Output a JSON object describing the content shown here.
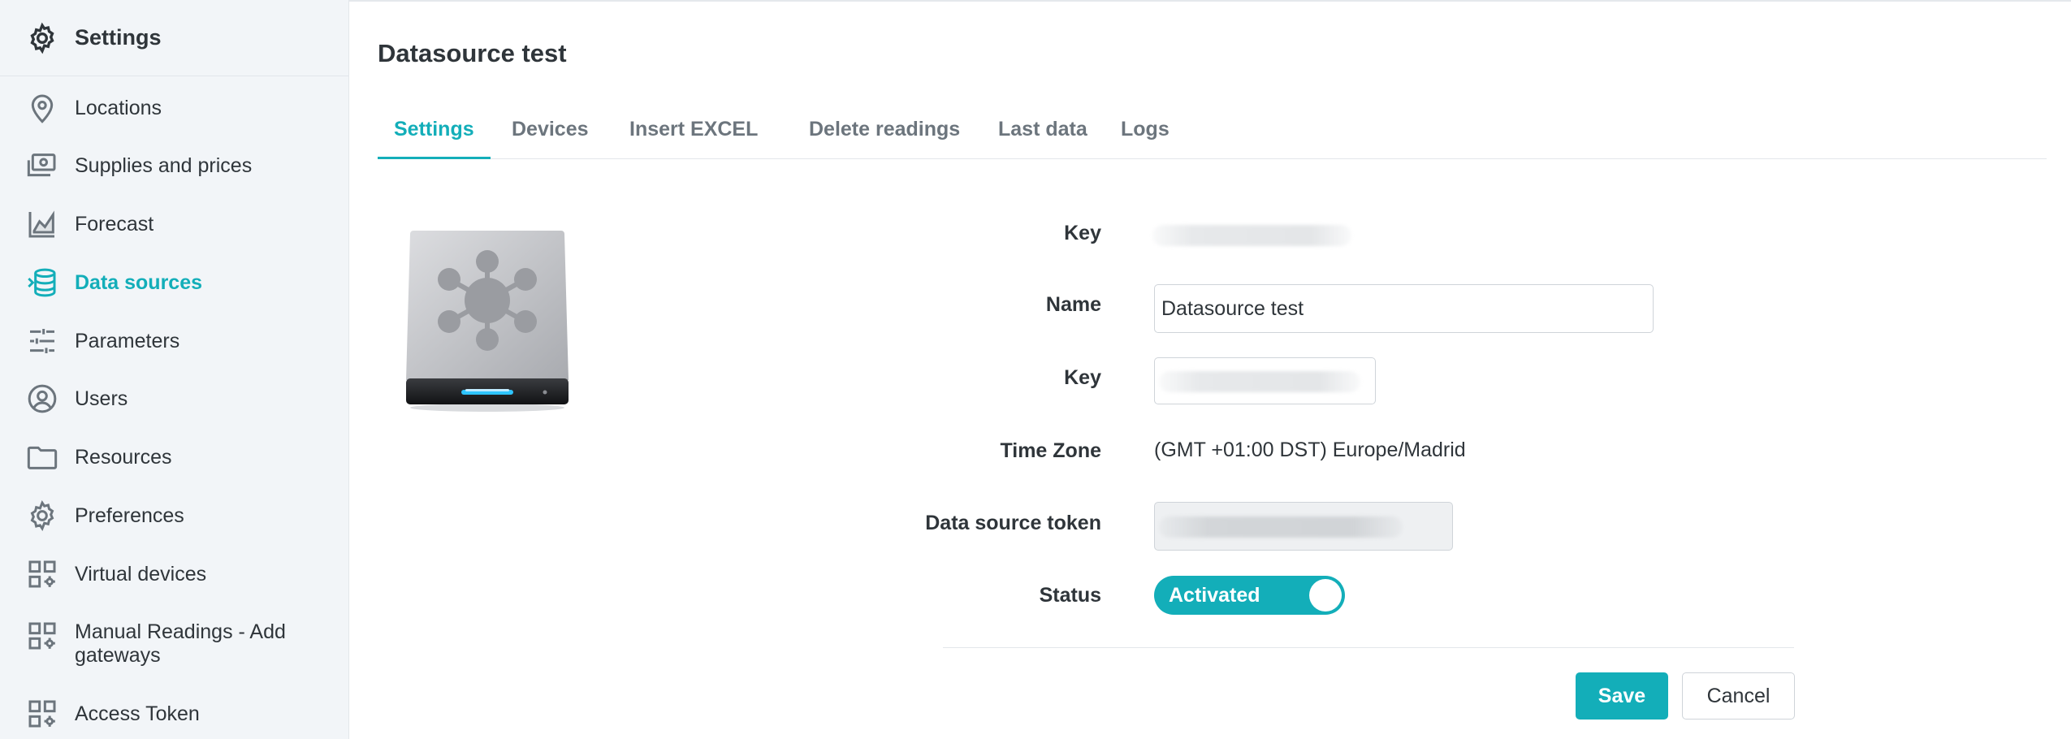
{
  "sidebar": {
    "header": {
      "title": "Settings",
      "icon": "gear-icon"
    },
    "items": [
      {
        "label": "Locations",
        "icon": "map-pin-icon",
        "active": false
      },
      {
        "label": "Supplies and prices",
        "icon": "money-icon",
        "active": false
      },
      {
        "label": "Forecast",
        "icon": "chart-area-icon",
        "active": false
      },
      {
        "label": "Data sources",
        "icon": "database-icon",
        "active": true
      },
      {
        "label": "Parameters",
        "icon": "sliders-icon",
        "active": false
      },
      {
        "label": "Users",
        "icon": "user-circle-icon",
        "active": false
      },
      {
        "label": "Resources",
        "icon": "folder-icon",
        "active": false
      },
      {
        "label": "Preferences",
        "icon": "gear-icon",
        "active": false
      },
      {
        "label": "Virtual devices",
        "icon": "grid-gear-icon",
        "active": false
      },
      {
        "label": "Manual Readings - Add gateways",
        "icon": "grid-gear-icon",
        "active": false
      },
      {
        "label": "Access Token",
        "icon": "grid-gear-icon",
        "active": false
      }
    ]
  },
  "page": {
    "title": "Datasource test"
  },
  "tabs": [
    {
      "label": "Settings",
      "active": true
    },
    {
      "label": "Devices",
      "active": false
    },
    {
      "label": "Insert EXCEL",
      "active": false
    },
    {
      "label": "Delete readings",
      "active": false
    },
    {
      "label": "Last data",
      "active": false
    },
    {
      "label": "Logs",
      "active": false
    }
  ],
  "form": {
    "key_label": "Key",
    "name_label": "Name",
    "name_value": "Datasource test",
    "key2_label": "Key",
    "timezone_label": "Time Zone",
    "timezone_value": "(GMT +01:00 DST) Europe/Madrid",
    "token_label": "Data source token",
    "status_label": "Status",
    "status_value": "Activated",
    "status_on": true
  },
  "actions": {
    "save": "Save",
    "cancel": "Cancel"
  },
  "colors": {
    "accent": "#13aeb9",
    "sidebar_bg": "#f2f5f8",
    "text": "#2f353a",
    "muted": "#6c757d"
  }
}
